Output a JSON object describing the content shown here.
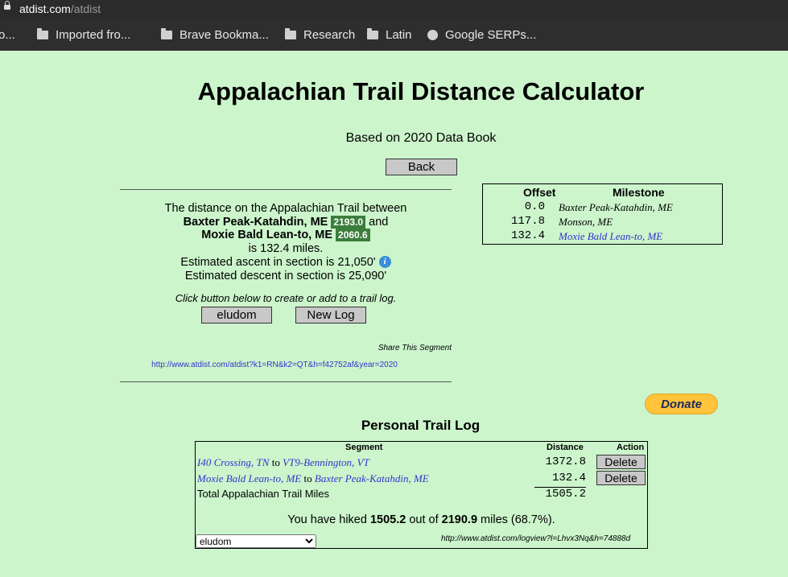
{
  "browser": {
    "url_domain": "atdist.com",
    "url_path": "/atdist",
    "bookmarks": [
      {
        "label": "o...",
        "icon": "folder-icon"
      },
      {
        "label": "Imported fro...",
        "icon": "folder-icon"
      },
      {
        "label": "Brave Bookma...",
        "icon": "folder-icon"
      },
      {
        "label": "Research",
        "icon": "folder-icon"
      },
      {
        "label": "Latin",
        "icon": "folder-icon"
      },
      {
        "label": "Google SERPs...",
        "icon": "globe-icon"
      }
    ]
  },
  "page": {
    "title": "Appalachian Trail Distance Calculator",
    "subtitle": "Based on 2020 Data Book",
    "back_label": "Back",
    "result": {
      "line1": "The distance on the Appalachian Trail between",
      "start_name": "Baxter Peak-Katahdin, ME",
      "start_mile": "2193.0",
      "and": "and",
      "end_name": "Moxie Bald Lean-to, ME",
      "end_mile": "2060.6",
      "distance_text": "is 132.4 miles.",
      "ascent": "Estimated ascent in section is 21,050'",
      "descent": "Estimated descent in section is 25,090'",
      "log_prompt": "Click button below to create or add to a trail log.",
      "log_button": "eludom",
      "new_log_button": "New Log",
      "share_label": "Share This Segment",
      "share_url": "http://www.atdist.com/atdist?k1=RN&k2=QT&h=f42752af&year=2020"
    },
    "milestones": {
      "headers": {
        "offset": "Offset",
        "milestone": "Milestone"
      },
      "rows": [
        {
          "offset": "0.0",
          "name": "Baxter Peak-Katahdin, ME",
          "link": false
        },
        {
          "offset": "117.8",
          "name": "Monson, ME",
          "link": false
        },
        {
          "offset": "132.4",
          "name": "Moxie Bald Lean-to, ME",
          "link": true
        }
      ]
    },
    "donate_label": "Donate",
    "log": {
      "title": "Personal Trail Log",
      "headers": {
        "segment": "Segment",
        "distance": "Distance",
        "action": "Action"
      },
      "rows": [
        {
          "from": "I40 Crossing, TN",
          "to_word": "to",
          "to": "VT9-Bennington, VT",
          "distance": "1372.8",
          "action": "Delete"
        },
        {
          "from": "Moxie Bald Lean-to, ME",
          "to_word": "to",
          "to": "Baxter Peak-Katahdin, ME",
          "distance": "132.4",
          "action": "Delete"
        }
      ],
      "total_label": "Total Appalachian Trail Miles",
      "total": "1505.2",
      "summary_pre": "You have hiked",
      "hiked": "1505.2",
      "summary_mid": "out of",
      "trail_total": "2190.9",
      "summary_post": "miles (68.7%).",
      "select_value": "eludom",
      "logview_url": "http://www.atdist.com/logview?l=Lhvx3Nq&h=74888d"
    }
  }
}
